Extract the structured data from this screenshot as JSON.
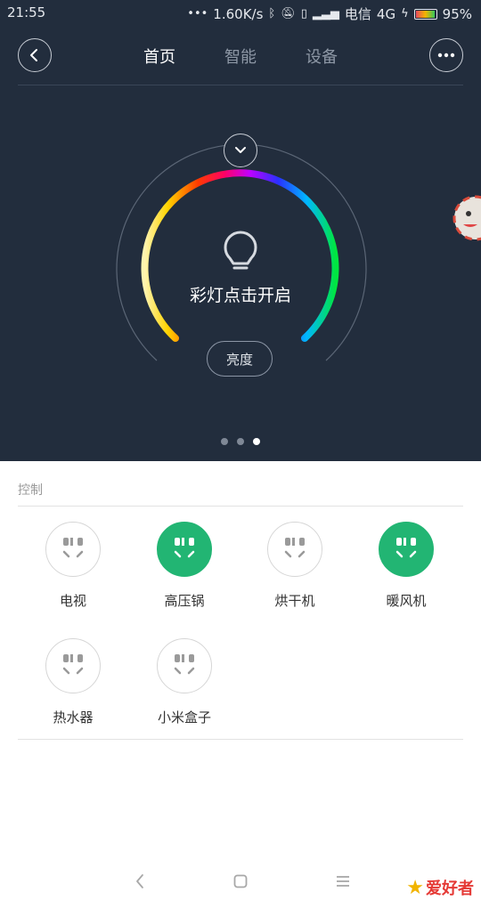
{
  "status_bar": {
    "time": "21:55",
    "net_speed": "1.60K/s",
    "carrier": "电信",
    "network": "4G",
    "battery": "95%",
    "icons": [
      "dots-icon",
      "bluetooth-icon",
      "mute-icon",
      "vibrate-icon",
      "signal-icon",
      "charging-icon",
      "battery-icon"
    ]
  },
  "header": {
    "tabs": [
      {
        "label": "首页",
        "active": true
      },
      {
        "label": "智能",
        "active": false
      },
      {
        "label": "设备",
        "active": false
      }
    ]
  },
  "lamp": {
    "status_text": "彩灯点击开启",
    "brightness_label": "亮度",
    "page_indicator": {
      "count": 3,
      "active_index": 2
    }
  },
  "controls": {
    "section_title": "控制",
    "devices": [
      {
        "label": "电视",
        "on": false
      },
      {
        "label": "高压锅",
        "on": true
      },
      {
        "label": "烘干机",
        "on": false
      },
      {
        "label": "暖风机",
        "on": true
      },
      {
        "label": "热水器",
        "on": false
      },
      {
        "label": "小米盒子",
        "on": false
      }
    ]
  },
  "watermark": {
    "text": "爱好者"
  },
  "colors": {
    "panel_bg": "#222d3d",
    "accent_green": "#22b573",
    "inactive_tab": "#8d97a5"
  }
}
